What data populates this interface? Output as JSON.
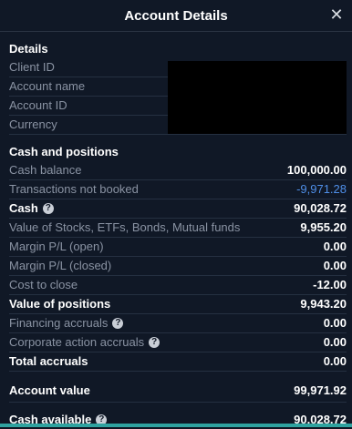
{
  "title": "Account Details",
  "close_icon": "close-icon",
  "details": {
    "heading": "Details",
    "rows": [
      {
        "label": "Client ID"
      },
      {
        "label": "Account name"
      },
      {
        "label": "Account ID"
      },
      {
        "label": "Currency"
      }
    ]
  },
  "cash_positions": {
    "heading": "Cash and positions",
    "rows": [
      {
        "label": "Cash balance",
        "value": "100,000.00"
      },
      {
        "label": "Transactions not booked",
        "value": "-9,971.28"
      },
      {
        "label": "Cash",
        "value": "90,028.72"
      },
      {
        "label": "Value of Stocks, ETFs, Bonds, Mutual funds",
        "value": "9,955.20"
      },
      {
        "label": "Margin P/L (open)",
        "value": "0.00"
      },
      {
        "label": "Margin P/L (closed)",
        "value": "0.00"
      },
      {
        "label": "Cost to close",
        "value": "-12.00"
      },
      {
        "label": "Value of positions",
        "value": "9,943.20"
      },
      {
        "label": "Financing accruals",
        "value": "0.00"
      },
      {
        "label": "Corporate action accruals",
        "value": "0.00"
      },
      {
        "label": "Total accruals",
        "value": "0.00"
      }
    ]
  },
  "summary": {
    "account_value_label": "Account value",
    "account_value": "99,971.92",
    "cash_available_label": "Cash available",
    "cash_available": "90,028.72"
  },
  "colors": {
    "background": "#101826",
    "accent_blue": "#4f8fe8",
    "bottom_bar": "#2fa3a0"
  }
}
